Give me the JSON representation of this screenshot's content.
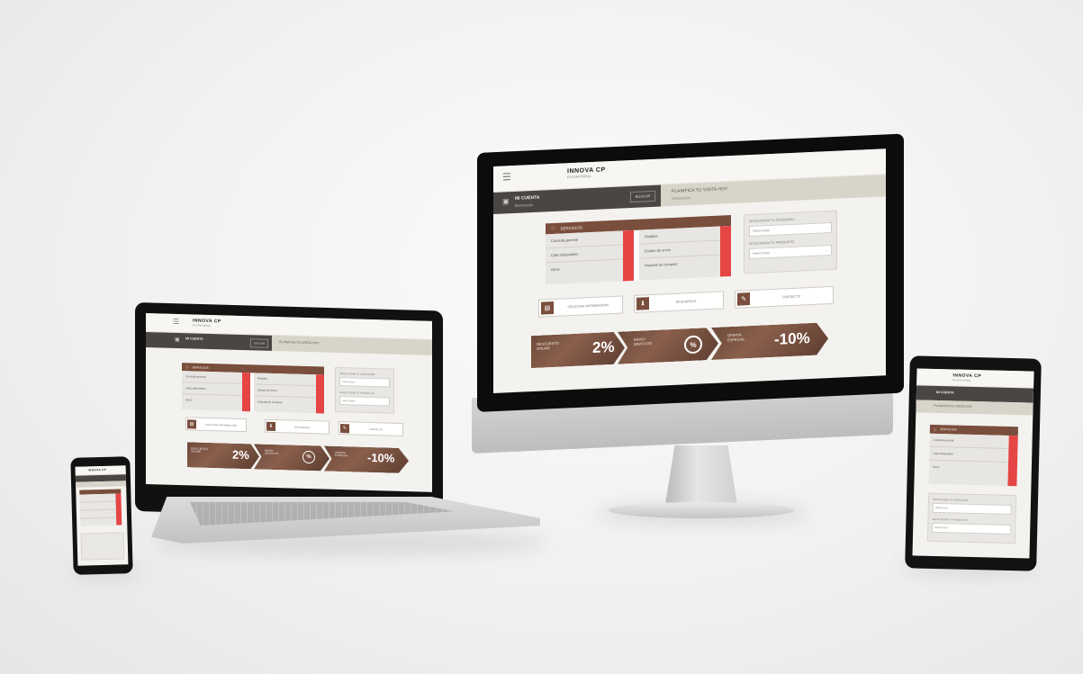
{
  "header": {
    "menu_icon": "hamburger-icon",
    "logo": "INNOVA CP",
    "logo_tagline": "PLATAFORMA",
    "account_label": "MI CUENTA",
    "account_sub": "Bienvenido",
    "search_button": "BUSCAR",
    "promo_text": "PLANIFICA TU VISITA HOY",
    "promo_sub": "Información"
  },
  "panel": {
    "title": "SERVICIOS",
    "left_items": [
      "Consulta general",
      "Citas disponibles",
      "Otros"
    ],
    "right_items": [
      "Pedidos",
      "Estado de envío",
      "Historial de compras"
    ]
  },
  "sidebar": {
    "label_1": "SELECCIONA TU CATEGORÍA",
    "select_1": "Seleccionar",
    "label_2": "SELECCIONA TU PRODUCTO",
    "select_2": "Seleccionar",
    "select_icon": "chevron-down-icon"
  },
  "buttons": [
    {
      "label": "SOLICITAR INFORMACIÓN",
      "icon": "document-icon"
    },
    {
      "label": "DESCARGAS",
      "icon": "download-icon"
    },
    {
      "label": "CONTACTO",
      "icon": "chat-icon"
    }
  ],
  "banner": {
    "seg1_caption": "DESCUENTO\nONLINE",
    "seg1_value": "2%",
    "seg2_caption": "ENVÍO\nGRATUITO",
    "seg2_ring": "%",
    "seg3_caption": "OFERTA\nESPECIAL",
    "seg3_value": "-10%"
  },
  "colors": {
    "accent_brown": "#7a4e3c",
    "accent_red": "#e54545",
    "dark_bar": "#4a4643",
    "light_bar": "#d8d4c9"
  }
}
